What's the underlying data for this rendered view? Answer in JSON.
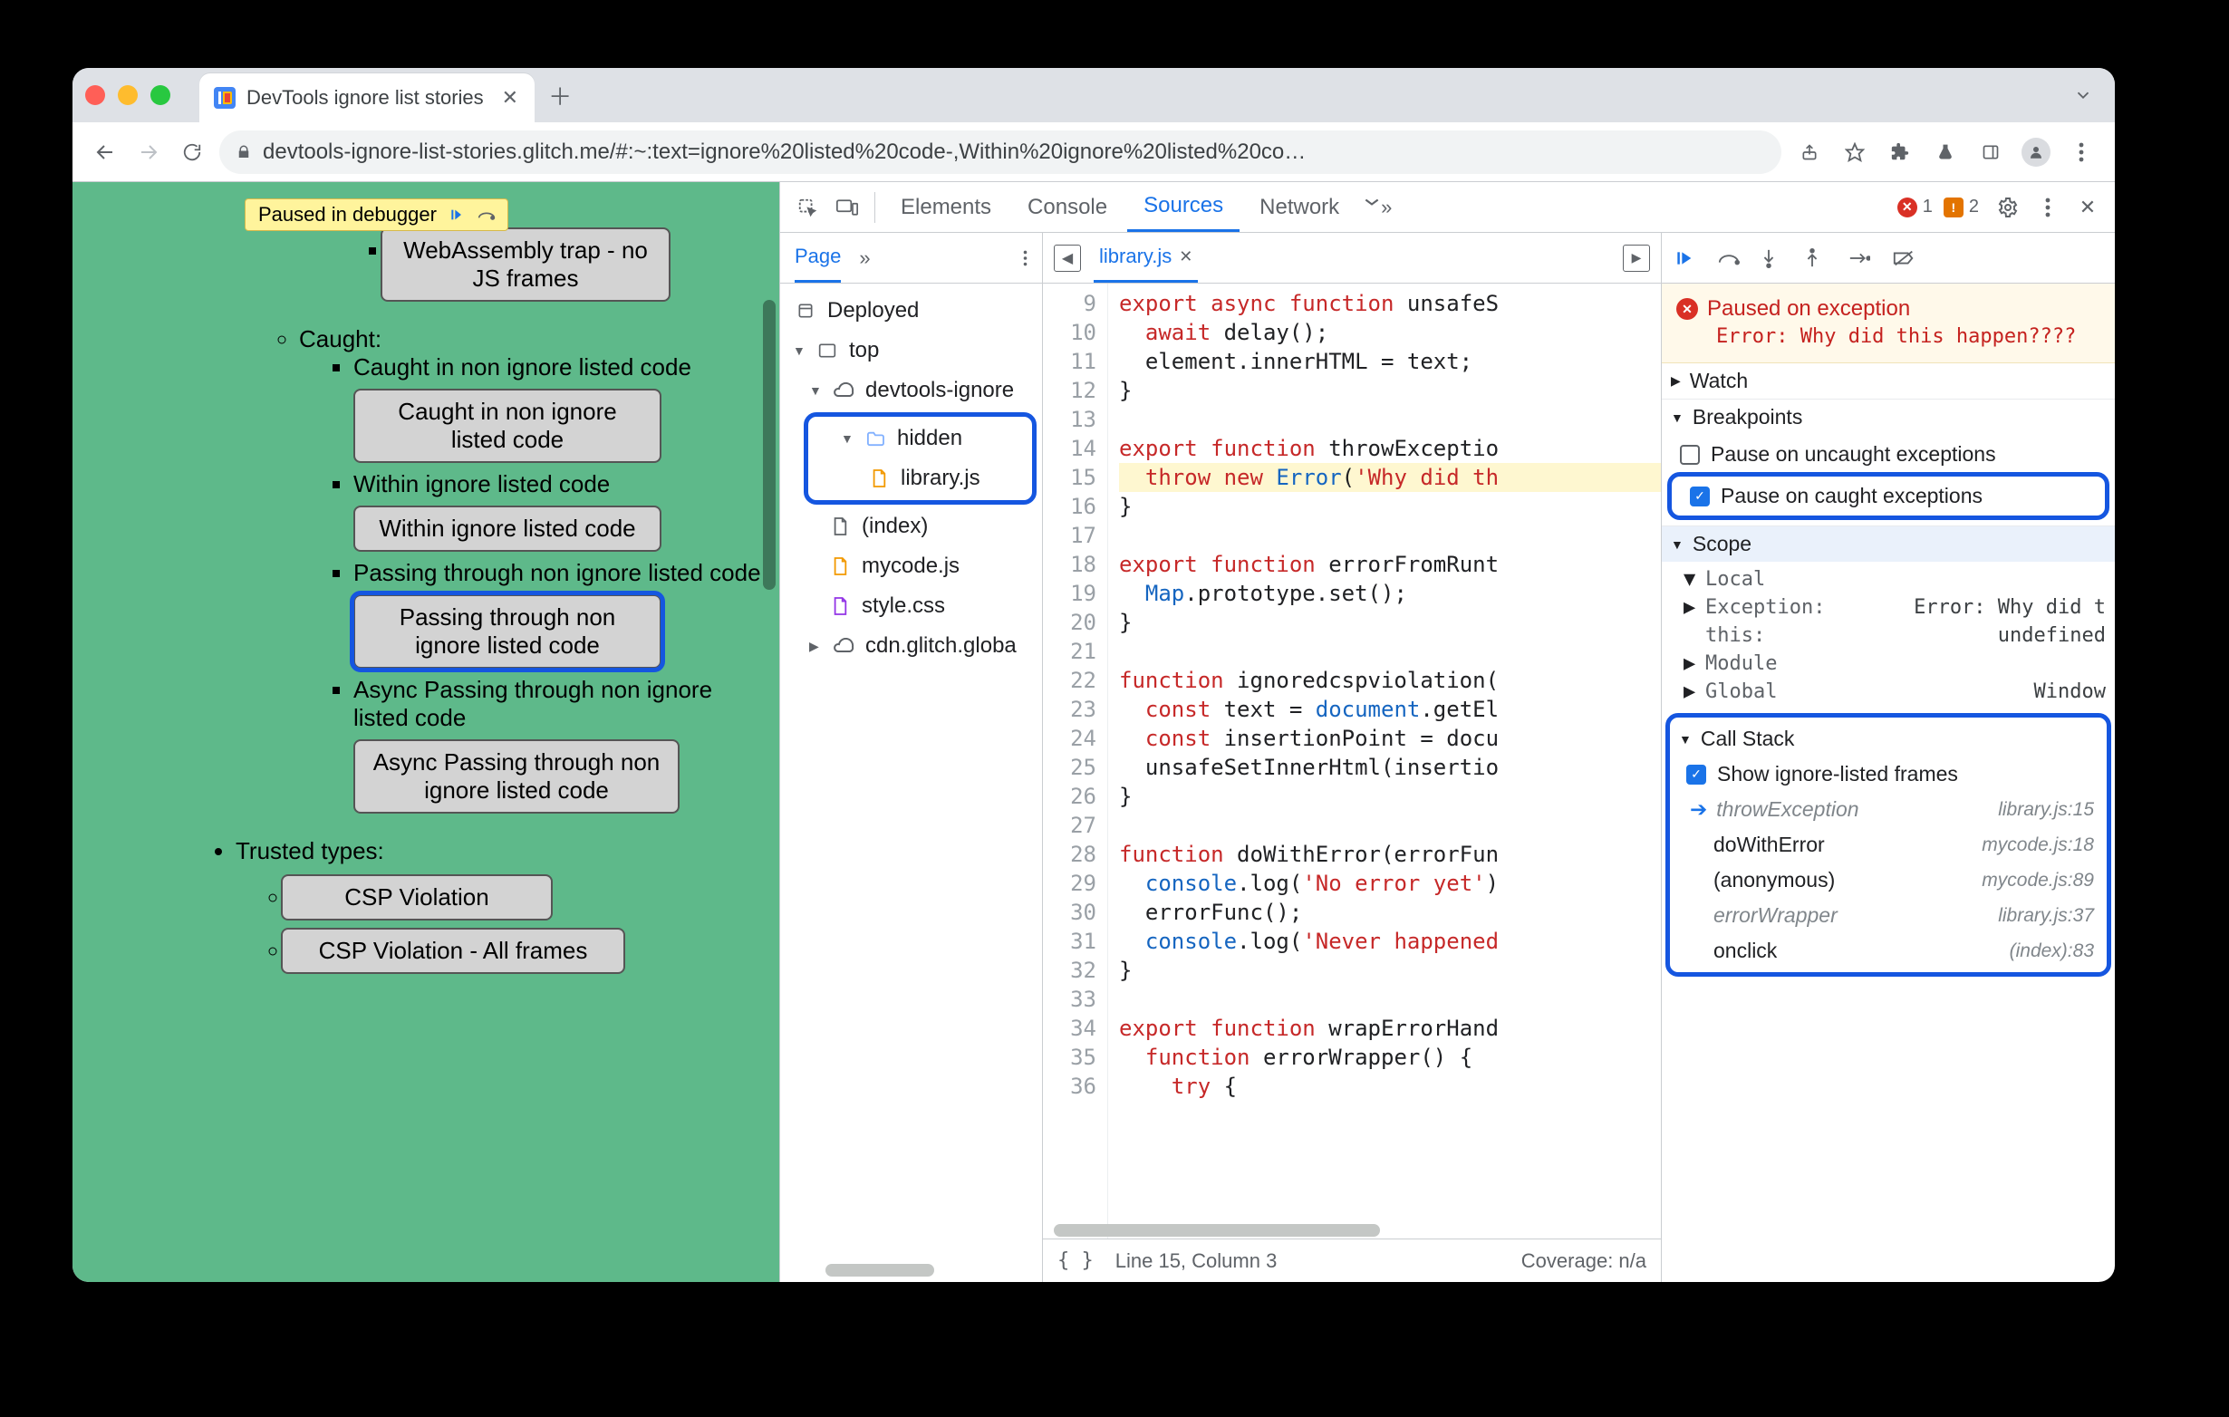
{
  "browser": {
    "tab_title": "DevTools ignore list stories",
    "url_display": "devtools-ignore-list-stories.glitch.me/#:~:text=ignore%20listed%20code-,Within%20ignore%20listed%20co…",
    "paused_chip": "Paused in debugger"
  },
  "page": {
    "button_truncated": "WebAssembly trap - no JS frames",
    "caught_heading": "Caught:",
    "items": [
      {
        "label": "Caught in non ignore listed code",
        "button": "Caught in non ignore listed code"
      },
      {
        "label": "Within ignore listed code",
        "button": "Within ignore listed code"
      },
      {
        "label": "Passing through non ignore listed code",
        "button": "Passing through non ignore listed code",
        "highlight": true
      },
      {
        "label": "Async Passing through non ignore listed code",
        "button": "Async Passing through non ignore listed code"
      }
    ],
    "trusted_types": "Trusted types:",
    "tt_items": [
      "CSP Violation",
      "CSP Violation - All frames"
    ]
  },
  "devtools": {
    "tabs": [
      "Elements",
      "Console",
      "Sources",
      "Network"
    ],
    "active_tab": "Sources",
    "error_count": "1",
    "warn_count": "2"
  },
  "navigator": {
    "header_tab": "Page",
    "tree": {
      "deployed": "Deployed",
      "top": "top",
      "origin": "devtools-ignore",
      "hidden_folder": "hidden",
      "library_js": "library.js",
      "index": "(index)",
      "mycode": "mycode.js",
      "style": "style.css",
      "cdn": "cdn.glitch.globa"
    }
  },
  "editor": {
    "filename": "library.js",
    "first_line_no": 9,
    "lines": [
      "export async function unsafeS",
      "  await delay();",
      "  element.innerHTML = text;",
      "}",
      "",
      "export function throwExceptio",
      "  throw new Error('Why did th",
      "}",
      "",
      "export function errorFromRunt",
      "  Map.prototype.set();",
      "}",
      "",
      "function ignoredcspviolation(",
      "  const text = document.getEl",
      "  const insertionPoint = docu",
      "  unsafeSetInnerHtml(insertio",
      "}",
      "",
      "function doWithError(errorFun",
      "  console.log('No error yet')",
      "  errorFunc();",
      "  console.log('Never happened",
      "}",
      "",
      "export function wrapErrorHand",
      "  function errorWrapper() {",
      "    try {"
    ],
    "highlight_line": 15,
    "status_line": "Line 15, Column 3",
    "coverage": "Coverage: n/a"
  },
  "debugger": {
    "paused_title": "Paused on exception",
    "paused_error": "Error: Why did this happen????",
    "watch": "Watch",
    "breakpoints": "Breakpoints",
    "bp_uncaught": "Pause on uncaught exceptions",
    "bp_caught": "Pause on caught exceptions",
    "scope": "Scope",
    "scope_rows": [
      {
        "caret": "▼",
        "label": "Local"
      },
      {
        "caret": "▶",
        "label": "Exception:",
        "val": "Error: Why did t"
      },
      {
        "caret": "",
        "label": "  this:",
        "val": "undefined"
      },
      {
        "caret": "▶",
        "label": "Module"
      },
      {
        "caret": "▶",
        "label": "Global",
        "val": "Window"
      }
    ],
    "callstack": "Call Stack",
    "show_ignored": "Show ignore-listed frames",
    "frames": [
      {
        "fn": "throwException",
        "loc": "library.js:15",
        "ignored": true,
        "current": true
      },
      {
        "fn": "doWithError",
        "loc": "mycode.js:18"
      },
      {
        "fn": "(anonymous)",
        "loc": "mycode.js:89"
      },
      {
        "fn": "errorWrapper",
        "loc": "library.js:37",
        "ignored": true
      },
      {
        "fn": "onclick",
        "loc": "(index):83"
      }
    ]
  }
}
